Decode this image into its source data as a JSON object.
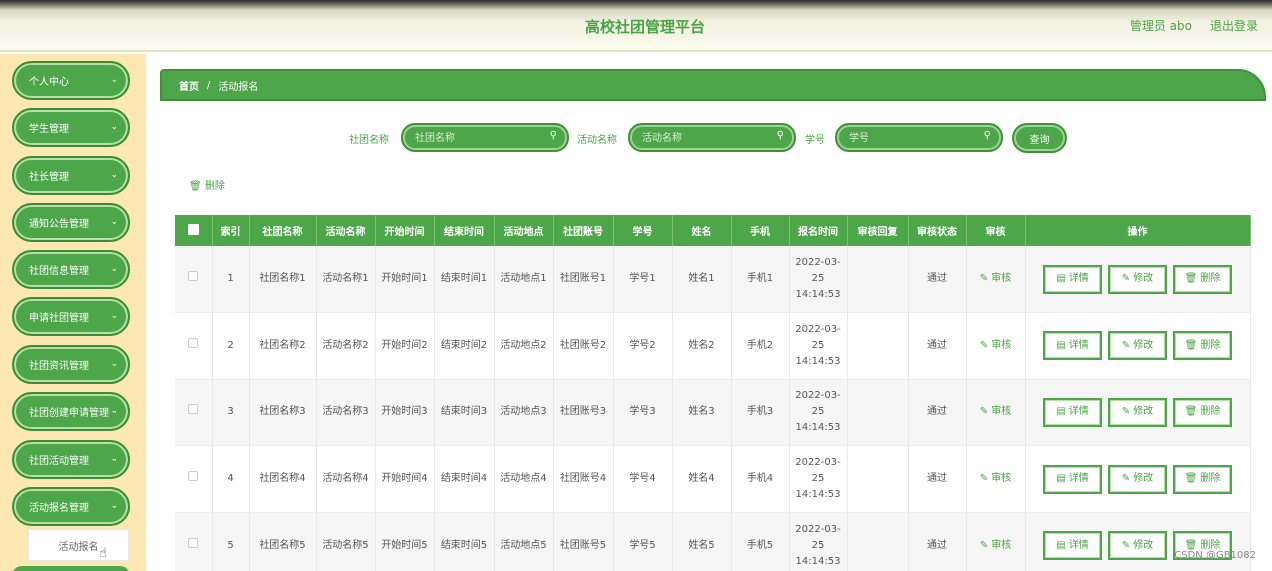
{
  "header": {
    "title": "高校社团管理平台",
    "admin_label": "管理员 abo",
    "logout": "退出登录"
  },
  "sidebar": {
    "items": [
      {
        "label": "个人中心"
      },
      {
        "label": "学生管理"
      },
      {
        "label": "社长管理"
      },
      {
        "label": "通知公告管理"
      },
      {
        "label": "社团信息管理"
      },
      {
        "label": "申请社团管理"
      },
      {
        "label": "社团资讯管理"
      },
      {
        "label": "社团创建申请管理"
      },
      {
        "label": "社团活动管理"
      },
      {
        "label": "活动报名管理"
      }
    ],
    "submenu_item": "活动报名",
    "chevron": "⌄"
  },
  "breadcrumb": {
    "home": "首页",
    "separator": "/",
    "current": "活动报名"
  },
  "search": {
    "club_label": "社团名称",
    "club_placeholder": "社团名称",
    "activity_label": "活动名称",
    "activity_placeholder": "活动名称",
    "student_label": "学号",
    "student_placeholder": "学号",
    "query_button": "查询"
  },
  "batch_delete": "删除",
  "table": {
    "headers": [
      "索引",
      "社团名称",
      "活动名称",
      "开始时间",
      "结束时间",
      "活动地点",
      "社团账号",
      "学号",
      "姓名",
      "手机",
      "报名时间",
      "审核回复",
      "审核状态",
      "审核",
      "操作"
    ],
    "audit_label": "审核",
    "op_labels": {
      "detail": "详情",
      "edit": "修改",
      "delete": "删除"
    },
    "rows": [
      {
        "index": "1",
        "club": "社团名称1",
        "activity": "活动名称1",
        "start": "开始时间1",
        "end": "结束时间1",
        "place": "活动地点1",
        "account": "社团账号1",
        "student_no": "学号1",
        "name": "姓名1",
        "phone": "手机1",
        "signup_time": "2022-03-25 14:14:53",
        "reply": "",
        "status": "通过"
      },
      {
        "index": "2",
        "club": "社团名称2",
        "activity": "活动名称2",
        "start": "开始时间2",
        "end": "结束时间2",
        "place": "活动地点2",
        "account": "社团账号2",
        "student_no": "学号2",
        "name": "姓名2",
        "phone": "手机2",
        "signup_time": "2022-03-25 14:14:53",
        "reply": "",
        "status": "通过"
      },
      {
        "index": "3",
        "club": "社团名称3",
        "activity": "活动名称3",
        "start": "开始时间3",
        "end": "结束时间3",
        "place": "活动地点3",
        "account": "社团账号3",
        "student_no": "学号3",
        "name": "姓名3",
        "phone": "手机3",
        "signup_time": "2022-03-25 14:14:53",
        "reply": "",
        "status": "通过"
      },
      {
        "index": "4",
        "club": "社团名称4",
        "activity": "活动名称4",
        "start": "开始时间4",
        "end": "结束时间4",
        "place": "活动地点4",
        "account": "社团账号4",
        "student_no": "学号4",
        "name": "姓名4",
        "phone": "手机4",
        "signup_time": "2022-03-25 14:14:53",
        "reply": "",
        "status": "通过"
      },
      {
        "index": "5",
        "club": "社团名称5",
        "activity": "活动名称5",
        "start": "开始时间5",
        "end": "结束时间5",
        "place": "活动地点5",
        "account": "社团账号5",
        "student_no": "学号5",
        "name": "姓名5",
        "phone": "手机5",
        "signup_time": "2022-03-25 14:14:53",
        "reply": "",
        "status": "通过"
      }
    ]
  },
  "watermark": "CSDN @GB1082",
  "colors": {
    "primary": "#4ea64a",
    "sidebar_bg": "#fde8b4"
  }
}
